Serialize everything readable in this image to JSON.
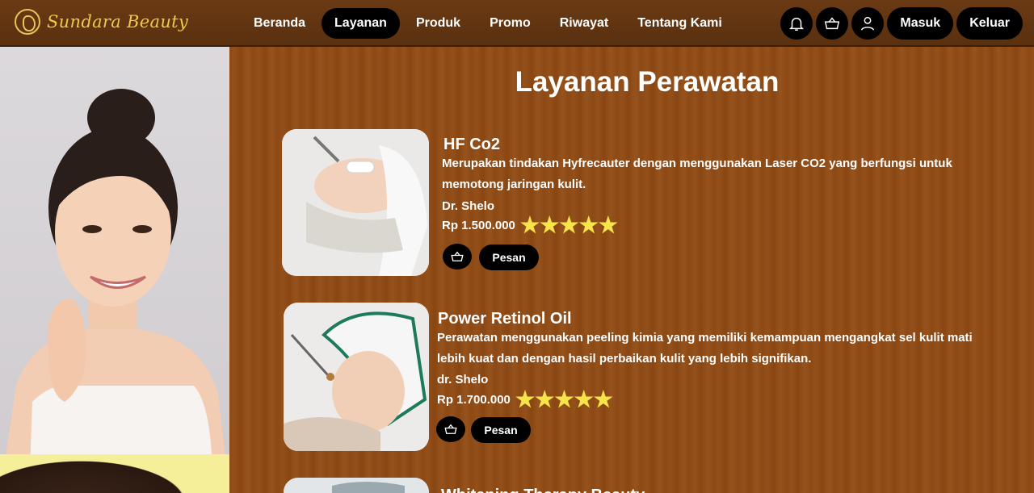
{
  "brand": {
    "name": "Sundara Beauty",
    "logo_icon": "lotus-face-icon"
  },
  "nav": {
    "links": [
      {
        "label": "Beranda",
        "active": false
      },
      {
        "label": "Layanan",
        "active": true
      },
      {
        "label": "Produk",
        "active": false
      },
      {
        "label": "Promo",
        "active": false
      },
      {
        "label": "Riwayat",
        "active": false
      },
      {
        "label": "Tentang Kami",
        "active": false
      }
    ],
    "icons": [
      "bell-icon",
      "basket-icon",
      "user-icon"
    ],
    "login_label": "Masuk",
    "logout_label": "Keluar"
  },
  "page": {
    "title": "Layanan Perawatan"
  },
  "services": [
    {
      "name": "HF Co2",
      "description": "Merupakan tindakan Hyfrecauter dengan menggunakan Laser CO2 yang berfungsi untuk memotong jaringan kulit.",
      "doctor": "Dr. Shelo",
      "price": "Rp 1.500.000",
      "rating": 5,
      "order_label": "Pesan"
    },
    {
      "name": "Power Retinol Oil",
      "description": "Perawatan menggunakan peeling kimia yang memiliki kemampuan mengangkat sel kulit mati lebih kuat dan dengan hasil perbaikan kulit yang lebih signifikan.",
      "doctor": "dr. Shelo",
      "price": "Rp 1.700.000",
      "rating": 5,
      "order_label": "Pesan"
    },
    {
      "name": "Whitening Therapy Beauty",
      "description": "",
      "doctor": "",
      "price": "",
      "rating": 0,
      "order_label": ""
    }
  ],
  "colors": {
    "nav_bg": "#5a300f",
    "page_bg": "#8d4a15",
    "brand": "#f0c84a",
    "star": "#f7e34a",
    "button": "#000000"
  }
}
